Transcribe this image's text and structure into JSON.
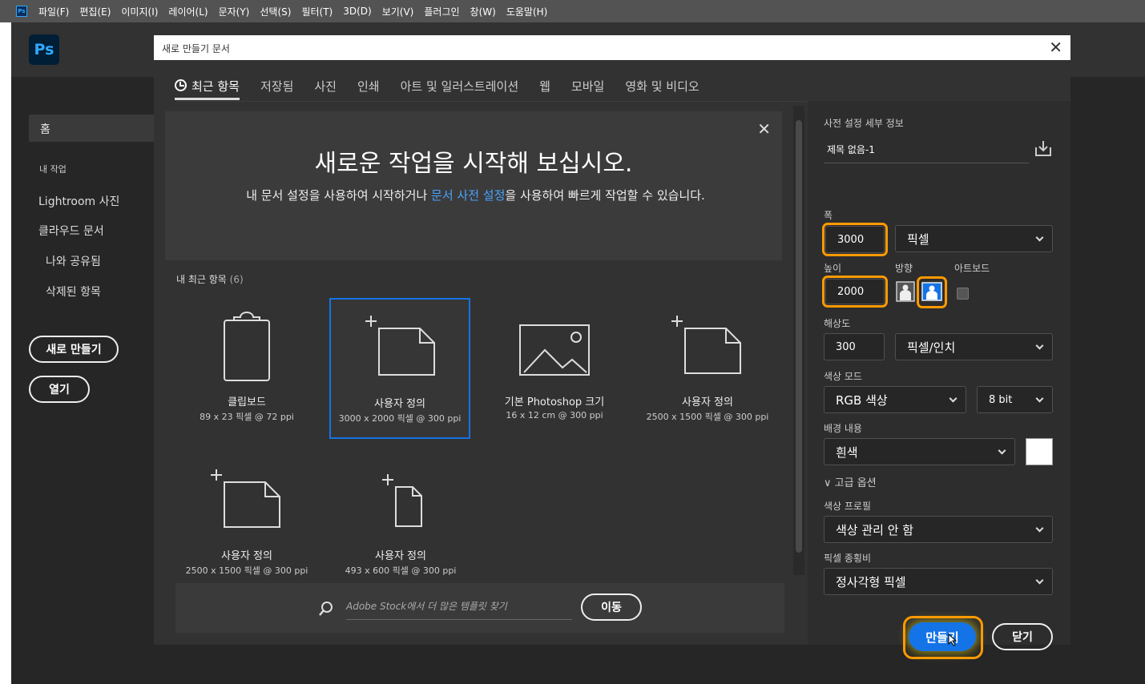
{
  "menubar": {
    "items": [
      "파일(F)",
      "편집(E)",
      "이미지(I)",
      "레이어(L)",
      "문자(Y)",
      "선택(S)",
      "필터(T)",
      "3D(D)",
      "보기(V)",
      "플러그인",
      "창(W)",
      "도움말(H)"
    ]
  },
  "app": {
    "logo": "Ps",
    "sidebar": {
      "home": "홈",
      "my_work": "내 작업",
      "items": [
        "Lightroom 사진",
        "클라우드 문서"
      ],
      "sub_items": [
        "나와 공유됨",
        "삭제된 항목"
      ],
      "new_button": "새로 만들기",
      "open_button": "열기"
    }
  },
  "dialog": {
    "title": "새로 만들기 문서",
    "tabs": [
      "최근 항목",
      "저장됨",
      "사진",
      "인쇄",
      "아트 및 일러스트레이션",
      "웹",
      "모바일",
      "영화 및 비디오"
    ],
    "banner": {
      "heading": "새로운 작업을 시작해 보십시오.",
      "text_before": "내 문서 설정을 사용하여 시작하거나 ",
      "link": "문서 사전 설정",
      "text_after": "을 사용하여 빠르게 작업할 수 있습니다."
    },
    "recent_label": "내 최근 항목",
    "recent_count": "(6)",
    "presets": [
      {
        "name": "클립보드",
        "detail": "89 x 23 픽셀 @ 72 ppi",
        "icon": "clipboard-icon"
      },
      {
        "name": "사용자 정의",
        "detail": "3000 x 2000 픽셀 @ 300 ppi",
        "icon": "custom-document-icon",
        "selected": true
      },
      {
        "name": "기본 Photoshop 크기",
        "detail": "16 x 12 cm @ 300 ppi",
        "icon": "image-icon"
      },
      {
        "name": "사용자 정의",
        "detail": "2500 x 1500 픽셀 @ 300 ppi",
        "icon": "custom-document-icon"
      },
      {
        "name": "사용자 정의",
        "detail": "2500 x 1500 픽셀 @ 300 ppi",
        "icon": "custom-document-icon"
      },
      {
        "name": "사용자 정의",
        "detail": "493 x 600 픽셀 @ 300 ppi",
        "icon": "custom-portrait-document-icon"
      }
    ],
    "search": {
      "placeholder": "Adobe Stock에서 더 많은 템플릿 찾기",
      "go_button": "이동"
    },
    "details": {
      "heading": "사전 설정 세부 정보",
      "doc_name": "제목 없음-1",
      "width_label": "폭",
      "width_value": "3000",
      "width_unit": "픽셀",
      "height_label": "높이",
      "height_value": "2000",
      "orientation_label": "방향",
      "artboard_label": "아트보드",
      "resolution_label": "해상도",
      "resolution_value": "300",
      "resolution_unit": "픽셀/인치",
      "color_mode_label": "색상 모드",
      "color_mode": "RGB 색상",
      "bit_depth": "8 bit",
      "background_label": "배경 내용",
      "background": "흰색",
      "background_swatch": "#ffffff",
      "advanced_label": "고급 옵션",
      "profile_label": "색상 프로필",
      "profile": "색상 관리 안 함",
      "pixel_aspect_label": "픽셀 종횡비",
      "pixel_aspect": "정사각형 픽셀",
      "create_button": "만들기",
      "close_button": "닫기"
    }
  },
  "colors": {
    "accent": "#1473e6",
    "highlight": "#ff9a00",
    "link": "#4aa3ff"
  }
}
